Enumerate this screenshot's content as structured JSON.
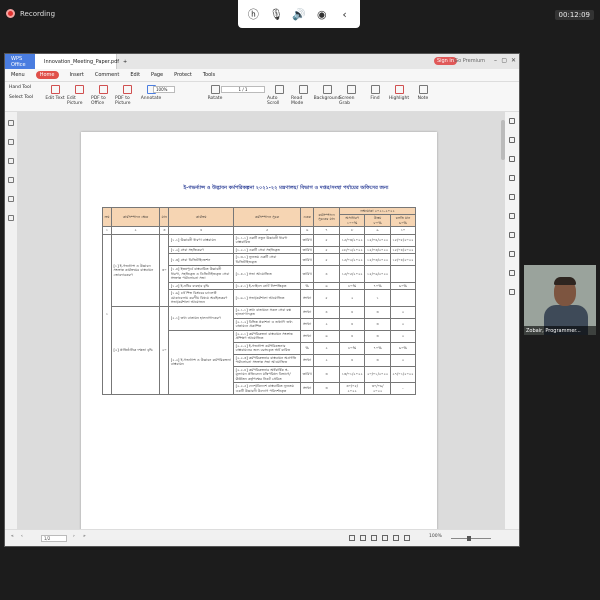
{
  "meeting": {
    "recording_label": "Recording",
    "elapsed_time": "00:12:09",
    "controls": [
      "hp-logo-icon",
      "microphone-icon",
      "volume-icon",
      "broadcast-icon",
      "back-icon"
    ]
  },
  "app": {
    "tabs": [
      "WPS Office",
      "Innovation_Meeting_Paper.pdf"
    ],
    "sign_in": "Sign in",
    "go_premium": "Go Premium",
    "menu": [
      "Menu",
      "Home",
      "Insert",
      "Comment",
      "Edit",
      "Page",
      "Protect",
      "Tools"
    ],
    "left_tools": [
      "Hand Tool",
      "Select Tool"
    ],
    "tools": [
      "Edit Text",
      "Edit Picture",
      "PDF to Office",
      "PDF to Picture",
      "Annotate",
      "Rotate",
      "Auto Scroll",
      "Read Mode",
      "Background",
      "Screen Grab",
      "Find",
      "Highlight",
      "Note"
    ],
    "zoom_value": "100%",
    "page_indicator": "1 / 1",
    "status_page": "1/2",
    "status_zoom": "100%"
  },
  "document": {
    "title": "ই-গভর্ন্যান্স ও উদ্ভাবন কর্মপরিকল্পনা ২০২১-২২ মন্ত্রণালয়/ বিভাগ ও দপ্তর/সংস্থা পর্যায়ের অফিসের জন্য",
    "header_row": [
      "ক্রম",
      "কার্যসম্পাদন ক্ষেত্র",
      "মান",
      "কার্যক্রম",
      "কর্মসম্পাদন সূচক",
      "একক",
      "কর্মসম্পাদন সূচকের মান",
      "লক্ষ্যমাত্রা ২০২১-২০২২"
    ],
    "target_levels": [
      "অসাধারণ",
      "উত্তম",
      "চলতি মান"
    ],
    "target_percent": [
      "১০০%",
      "৮০%",
      "৬০%"
    ],
    "column_numbers": [
      "১",
      "২",
      "৩",
      "৪",
      "৫",
      "৬",
      "৭",
      "৮",
      "৯",
      "১০"
    ],
    "row_number": "১",
    "areas": [
      "[১] ই-গভর্ন্যান্স ও উদ্ভাবন সংক্রান্ত কার্যক্রমের বাস্তবায়ন জোরদারকরণ",
      "[২] প্রাতিষ্ঠানিক দক্ষতা বৃদ্ধি"
    ],
    "marks": [
      "৩০",
      "২০"
    ],
    "rows": [
      {
        "activity": "[১.১] উদ্ভাবনী ধারণা বাস্তবায়ন",
        "indicator": "[১.১.১] একটি নতুন উদ্ভাবনী ধারণা বাস্তবায়িত",
        "unit": "তারিখ",
        "weight": "৫",
        "v1": "১৫/০৩/২০২২",
        "v2": "১৫/০৪/২০২২",
        "v3": "১৫/০৫/২০২২"
      },
      {
        "activity": "[১.২] সেবা সহজিকরণ",
        "indicator": "[১.২.১] একটি সেবা সহজিকৃত",
        "unit": "তারিখ",
        "weight": "৫",
        "v1": "২৮/০২/২০২২",
        "v2": "১৫/০৩/২০২২",
        "v3": "১৫/০৪/২০২২"
      },
      {
        "activity": "[১.৩] সেবা ডিজিটাইজেশন",
        "indicator": "[১.৩.১] ন্যূনতম একটি সেবা ডিজিটাইজকৃত",
        "unit": "তারিখ",
        "weight": "৫",
        "v1": "১৫/০২/২০২২",
        "v2": "১৫/০৩/২০২২",
        "v3": "১৫/০৪/২০২২"
      },
      {
        "activity": "[১.৪] ইতঃপূর্বে বাস্তবায়িত উদ্ভাবনী ধারণা, সহজিকৃত ও ডিজিটাইজকৃত সেবা সংক্রান্ত পর্যালোচনা সভা",
        "indicator": "[১.৪.১] সভা আয়োজিত",
        "unit": "তারিখ",
        "weight": "৪",
        "v1": "১৫/০৫/২০২২",
        "v2": "১৫/০৬/২০২২",
        "v3": ""
      },
      {
        "activity": "[১.৫] ই-নথির ব্যবহার বৃদ্ধি",
        "indicator": "[১.৫.১] ই-ফাইলে নোট নিষ্পত্তিকৃত",
        "unit": "%",
        "weight": "৬",
        "v1": "৮০%",
        "v2": "৭০%",
        "v3": "৬০%"
      },
      {
        "activity": "[১.৬] ৪র্থ শিল্প বিপ্লবের চ্যালেঞ্জ মোকাবেলায় করণীয় বিষয়ে অবহিতকরণ সভা/কর্মশালা আয়োজন",
        "indicator": "[১.৬.১] সভা/কর্মশালা আয়োজিত",
        "unit": "সংখ্যা",
        "weight": "৫",
        "v1": "২",
        "v2": "১",
        "v3": ""
      },
      {
        "activity": "[২.১] তথ্য বাতায়ন হালনাগাদকরণ",
        "indicator": "[২.১.১] তথ্য বাতায়নে সকল সেবা বক্স হালনাগাদকৃত",
        "unit": "সংখ্যা",
        "weight": "৪",
        "v1": "৪",
        "v2": "৩",
        "v3": "২"
      },
      {
        "activity": "",
        "indicator": "[২.১.২] বিভিন্ন প্রকাশনা ও তথ্যাদি তথ্য বাতায়নে প্রকাশিত",
        "unit": "সংখ্যা",
        "weight": "২",
        "v1": "৪",
        "v2": "৩",
        "v3": "২"
      },
      {
        "activity": "[২.২] ই-গভর্ন্যান্স ও উদ্ভাবন কর্মপরিকল্পনা বাস্তবায়ন",
        "indicator": "[২.২.১] কর্মপরিকল্পনা বাস্তবায়ন সংক্রান্ত প্রশিক্ষণ আয়োজিত",
        "unit": "সংখ্যা",
        "weight": "৬",
        "v1": "৪",
        "v2": "৩",
        "v3": "২"
      },
      {
        "activity": "",
        "indicator": "[২.২.২] ই-গভর্ন্যান্স কর্মপরিকল্পনার বাস্তবায়নের জন্য বরাদ্দকৃত অর্থ ব্যয়িত",
        "unit": "%",
        "weight": "২",
        "v1": "৮০%",
        "v2": "৭০%",
        "v3": "৬০%"
      },
      {
        "activity": "",
        "indicator": "[২.২.৩] কর্মপরিকল্পনার বাস্তবায়ন অগ্রগতি পর্যালোচনা সংক্রান্ত সভা আয়োজিত",
        "unit": "সংখ্যা",
        "weight": "২",
        "v1": "৪",
        "v2": "৩",
        "v3": "২"
      },
      {
        "activity": "",
        "indicator": "[২.২.৪] কর্মপরিকল্পনার অর্ধবার্ষিক স্ব-মূল্যায়ন প্রতিবেদন মন্ত্রিপরিষদ বিভাগে/ঊর্ধ্বতন কর্তৃপক্ষের নিকট প্রেরিত",
        "unit": "তারিখ",
        "weight": "৩",
        "v1": "১৩/০১/২০২২",
        "v2": "২০/০১/২০২২",
        "v3": "২৭/০১/২০২২"
      },
      {
        "activity": "",
        "indicator": "[২.২.৫] দেশে/বিদেশে বাস্তবায়িত ন্যূনতম একটি উদ্ভাবনী উদ্যোগ পরিদর্শনকৃত",
        "unit": "সংখ্যা",
        "weight": "৩",
        "v1": "৩০/০৫/ ২০২২",
        "v2": "৩০/০৬/ ২০২২",
        "v3": "-"
      }
    ]
  },
  "participant": {
    "name": "Zobair, Programmer..."
  }
}
